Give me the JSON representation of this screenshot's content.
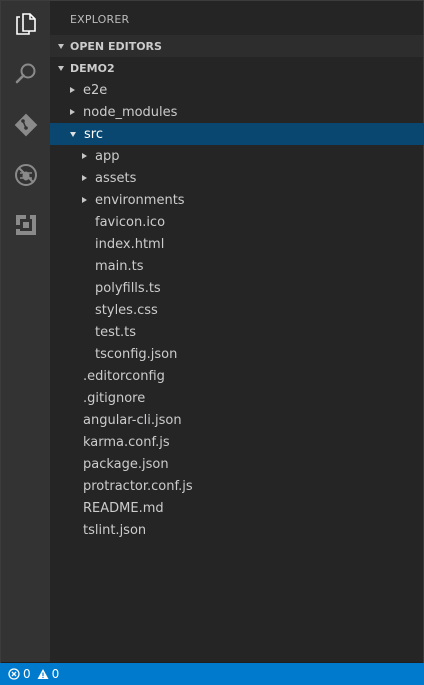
{
  "activity_bar": {
    "items": [
      {
        "name": "explorer-icon"
      },
      {
        "name": "search-icon"
      },
      {
        "name": "git-icon"
      },
      {
        "name": "debug-icon"
      },
      {
        "name": "extensions-icon"
      }
    ]
  },
  "sidebar": {
    "title": "EXPLORER",
    "sections": {
      "open_editors": "OPEN EDITORS",
      "project": "DEMO2"
    },
    "tree": [
      {
        "label": "e2e",
        "type": "folder",
        "expanded": false,
        "depth": 1
      },
      {
        "label": "node_modules",
        "type": "folder",
        "expanded": false,
        "depth": 1
      },
      {
        "label": "src",
        "type": "folder",
        "expanded": true,
        "depth": 1,
        "selected": true
      },
      {
        "label": "app",
        "type": "folder",
        "expanded": false,
        "depth": 2
      },
      {
        "label": "assets",
        "type": "folder",
        "expanded": false,
        "depth": 2
      },
      {
        "label": "environments",
        "type": "folder",
        "expanded": false,
        "depth": 2
      },
      {
        "label": "favicon.ico",
        "type": "file",
        "depth": 2
      },
      {
        "label": "index.html",
        "type": "file",
        "depth": 2
      },
      {
        "label": "main.ts",
        "type": "file",
        "depth": 2
      },
      {
        "label": "polyfills.ts",
        "type": "file",
        "depth": 2
      },
      {
        "label": "styles.css",
        "type": "file",
        "depth": 2
      },
      {
        "label": "test.ts",
        "type": "file",
        "depth": 2
      },
      {
        "label": "tsconfig.json",
        "type": "file",
        "depth": 2
      },
      {
        "label": ".editorconfig",
        "type": "file",
        "depth": 1
      },
      {
        "label": ".gitignore",
        "type": "file",
        "depth": 1
      },
      {
        "label": "angular-cli.json",
        "type": "file",
        "depth": 1
      },
      {
        "label": "karma.conf.js",
        "type": "file",
        "depth": 1
      },
      {
        "label": "package.json",
        "type": "file",
        "depth": 1
      },
      {
        "label": "protractor.conf.js",
        "type": "file",
        "depth": 1
      },
      {
        "label": "README.md",
        "type": "file",
        "depth": 1
      },
      {
        "label": "tslint.json",
        "type": "file",
        "depth": 1
      }
    ]
  },
  "status_bar": {
    "errors": "0",
    "warnings": "0",
    "error_icon": "error-icon",
    "warning_icon": "warning-icon"
  },
  "colors": {
    "activity_bar": "#333333",
    "sidebar": "#252526",
    "selection": "#094771",
    "status_bar": "#007acc"
  }
}
